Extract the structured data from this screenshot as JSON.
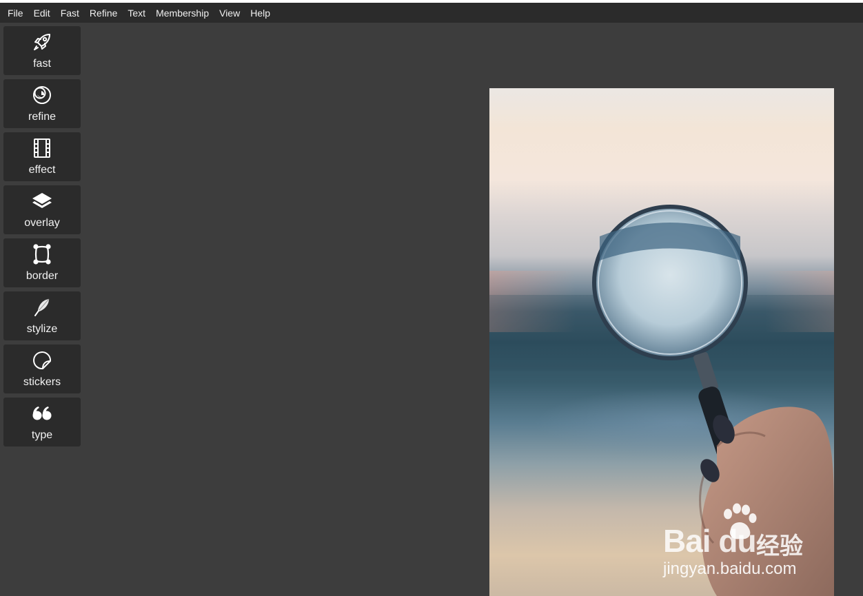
{
  "menu": [
    "File",
    "Edit",
    "Fast",
    "Refine",
    "Text",
    "Membership",
    "View",
    "Help"
  ],
  "tools": [
    {
      "label": "fast",
      "icon": "rocket-icon"
    },
    {
      "label": "refine",
      "icon": "refine-circles-icon"
    },
    {
      "label": "effect",
      "icon": "film-strip-icon"
    },
    {
      "label": "overlay",
      "icon": "layers-icon"
    },
    {
      "label": "border",
      "icon": "frame-border-icon"
    },
    {
      "label": "stylize",
      "icon": "feather-pen-icon"
    },
    {
      "label": "stickers",
      "icon": "sticker-icon"
    },
    {
      "label": "type",
      "icon": "quote-icon"
    }
  ],
  "watermark": {
    "logo": "Bai du",
    "cn": "经验",
    "url": "jingyan.baidu.com"
  },
  "colors": {
    "background": "#3d3d3d",
    "menubar": "#2b2b2b",
    "tool_bg": "#2b2b2b",
    "text": "#f0f0f0"
  }
}
